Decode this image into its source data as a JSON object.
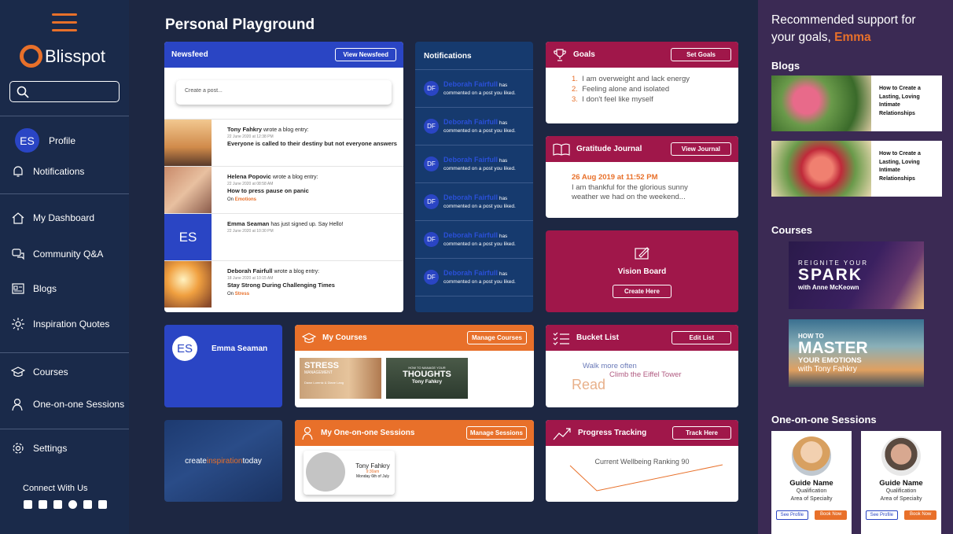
{
  "app": {
    "brand": "Blisspot"
  },
  "sidebar": {
    "profile": {
      "initials": "ES",
      "label": "Profile"
    },
    "items": [
      {
        "label": "Notifications"
      },
      {
        "label": "My Dashboard"
      },
      {
        "label": "Community Q&A"
      },
      {
        "label": "Blogs"
      },
      {
        "label": "Inspiration Quotes"
      },
      {
        "label": "Courses"
      },
      {
        "label": "One-on-one Sessions"
      },
      {
        "label": "Settings"
      }
    ],
    "connect": "Connect With Us"
  },
  "page": {
    "title": "Personal Playground"
  },
  "newsfeed": {
    "title": "Newsfeed",
    "button": "View Newsfeed",
    "placeholder": "Create a post...",
    "items": [
      {
        "author": "Tony Fahkry",
        "action": "wrote a blog entry:",
        "date": "22 June 2020 at 12:38 PM",
        "headline": "Everyone is called to their destiny but not everyone answers",
        "tag": ""
      },
      {
        "author": "Helena Popovic",
        "action": "wrote a blog entry:",
        "date": "22 June 2020 at 08:58 AM",
        "headline": "How to press pause on panic",
        "tag_prefix": "On",
        "tag": "Emotions"
      },
      {
        "author": "Emma Seaman",
        "action": "has just signed up. Say Hello!",
        "date": "22 June 2020 at 10:30 PM",
        "headline": "",
        "initials": "ES"
      },
      {
        "author": "Deborah Fairfull",
        "action": "wrote a blog entry:",
        "date": "18 June 2020 at 10:15 AM",
        "headline": "Stay Strong During Challenging Times",
        "tag_prefix": "On",
        "tag": "Stress"
      }
    ]
  },
  "notifications": {
    "title": "Notifications",
    "items": [
      {
        "initials": "DF",
        "name": "Deborah Fairfull",
        "text1": "has",
        "text2": "commented on a post you liked."
      },
      {
        "initials": "DF",
        "name": "Deborah Fairfull",
        "text1": "has",
        "text2": "commented on a post you liked."
      },
      {
        "initials": "DF",
        "name": "Deborah Fairfull",
        "text1": "has",
        "text2": "commented on a post you liked."
      },
      {
        "initials": "DF",
        "name": "Deborah Fairfull",
        "text1": "has",
        "text2": "commented on a post you liked."
      },
      {
        "initials": "DF",
        "name": "Deborah Fairfull",
        "text1": "has",
        "text2": "commented on a post you liked."
      },
      {
        "initials": "DF",
        "name": "Deborah Fairfull",
        "text1": "has",
        "text2": "commented on a post you liked."
      }
    ]
  },
  "goals": {
    "title": "Goals",
    "button": "Set Goals",
    "items": [
      {
        "n": "1.",
        "text": "I am overweight and lack energy"
      },
      {
        "n": "2.",
        "text": "Feeling alone and isolated"
      },
      {
        "n": "3.",
        "text": "I don't feel like myself"
      }
    ]
  },
  "journal": {
    "title": "Gratitude Journal",
    "button": "View Journal",
    "date": "26 Aug 2019 at 11:52 PM",
    "text": "I am thankful for the glorious sunny weather we had on the weekend..."
  },
  "vision": {
    "title": "Vision Board",
    "button": "Create Here"
  },
  "profile_card": {
    "initials": "ES",
    "name": "Emma Seaman"
  },
  "my_courses": {
    "title": "My Courses",
    "button": "Manage Courses",
    "c1": {
      "title": "STRESS",
      "sub": "MANAGEMENT",
      "authors": "Dawn Lorentz & Diane Lang"
    },
    "c2": {
      "pre": "HOW TO MANAGE YOUR",
      "title": "THOUGHTS",
      "author": "Tony Fahkry"
    }
  },
  "bucket": {
    "title": "Bucket List",
    "button": "Edit List",
    "w1": "Walk more often",
    "w2": "Climb the Eiffel Tower",
    "w3": "Read"
  },
  "inspiration": {
    "a": "create",
    "b": "inspiration",
    "c": "today"
  },
  "sessions": {
    "title": "My One-on-one Sessions",
    "button": "Manage Sessions",
    "name": "Tony Fahkry",
    "time": "9:30am",
    "date": "Monday 6th of July"
  },
  "progress": {
    "title": "Progress Tracking",
    "button": "Track Here",
    "label": "Current Wellbeing Ranking 90"
  },
  "right": {
    "heading_prefix": "Recommended support for your goals,",
    "heading_name": "Emma",
    "blogs_title": "Blogs",
    "blogs": [
      {
        "title": "How to Create a Lasting, Loving Intimate Relationships"
      },
      {
        "title": "How to Create a Lasting, Loving Intimate Relationships"
      }
    ],
    "courses_title": "Courses",
    "course1": {
      "l1": "REIGNITE YOUR",
      "l2": "SPARK",
      "l3": "with Anne McKeown"
    },
    "course2": {
      "l1": "HOW TO",
      "l2": "MASTER",
      "l3": "YOUR EMOTIONS",
      "l4": "with Tony Fahkry"
    },
    "sessions_title": "One-on-one Sessions",
    "guides": [
      {
        "name": "Guide Name",
        "qual": "Qualification",
        "area": "Area of Specialty",
        "profile": "See Profile",
        "book": "Book Now"
      },
      {
        "name": "Guide Name",
        "qual": "Qualification",
        "area": "Area of Specialty",
        "profile": "See Profile",
        "book": "Book Now"
      }
    ]
  },
  "colors": {
    "accent": "#e8702a",
    "blue": "#2a45c4",
    "crimson": "#a0174a",
    "navy": "#1a2a4a"
  }
}
